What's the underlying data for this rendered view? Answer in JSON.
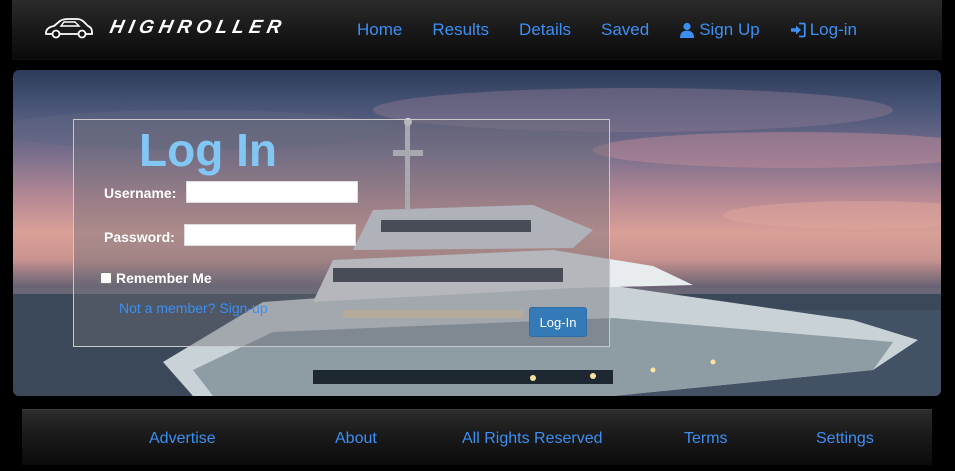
{
  "brand": {
    "name": "HIGHROLLER",
    "logo_icon": "car-icon"
  },
  "nav": {
    "items": [
      {
        "label": "Home"
      },
      {
        "label": "Results"
      },
      {
        "label": "Details"
      },
      {
        "label": "Saved"
      },
      {
        "label": "Sign Up",
        "icon": "user-icon"
      },
      {
        "label": "Log-in",
        "icon": "login-icon"
      }
    ]
  },
  "hero": {
    "background": "yacht-at-sunset"
  },
  "login": {
    "title": "Log In",
    "username_label": "Username:",
    "username_value": "",
    "password_label": "Password:",
    "password_value": "",
    "remember_label": "Remember Me",
    "remember_checked": false,
    "signup_text": "Not a member? Sign-up",
    "submit_label": "Log-In"
  },
  "footer": {
    "items": [
      {
        "label": "Advertise"
      },
      {
        "label": "About"
      },
      {
        "label": "All Rights Reserved"
      },
      {
        "label": "Terms"
      },
      {
        "label": "Settings"
      }
    ]
  },
  "colors": {
    "link": "#3b8ff3",
    "title": "#82c6f4",
    "button": "#337ab7",
    "background": "#000000"
  }
}
